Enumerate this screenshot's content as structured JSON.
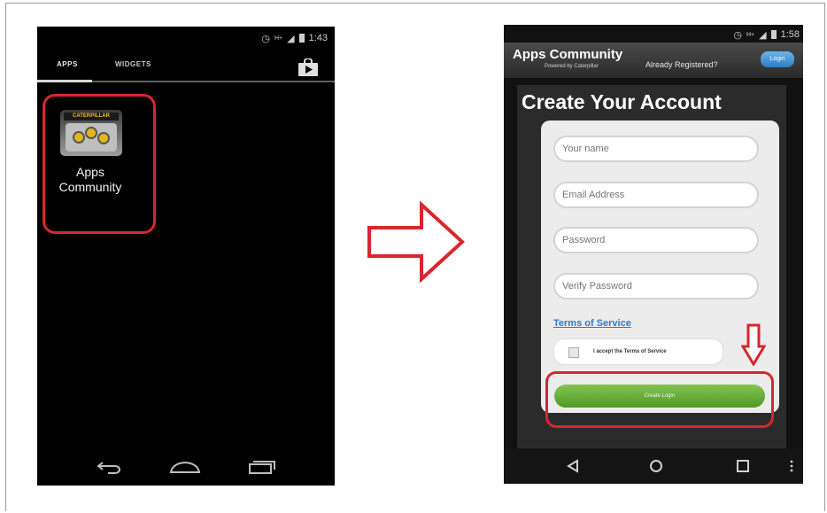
{
  "left_phone": {
    "status_time": "1:43",
    "status_network": "H+",
    "tabs": [
      {
        "label": "APPS",
        "active": true
      },
      {
        "label": "WIDGETS",
        "active": false
      }
    ],
    "store_icon": "play-store-bag-icon",
    "app": {
      "brand": "CATERPILLAR",
      "label_line1": "Apps",
      "label_line2": "Community"
    },
    "nav_icons": [
      "back-icon",
      "home-icon",
      "recent-apps-icon"
    ]
  },
  "right_phone": {
    "status_time": "1:58",
    "status_network": "H+",
    "header": {
      "title": "Apps Community",
      "subtitle": "Powered by Caterpillar",
      "already_registered": "Already Registered?",
      "login_label": "Login"
    },
    "heading": "Create Your Account",
    "fields": [
      {
        "name": "your-name-field",
        "placeholder": "Your name"
      },
      {
        "name": "email-field",
        "placeholder": "Email Address"
      },
      {
        "name": "password-field",
        "placeholder": "Password"
      },
      {
        "name": "verify-password-field",
        "placeholder": "Verify Password"
      }
    ],
    "terms_link": "Terms of Service",
    "accept_label": "I accept the Terms of Service",
    "create_button": "Create Login",
    "nav_icons": [
      "back-triangle-icon",
      "home-circle-icon",
      "recent-square-icon",
      "menu-dots-icon"
    ]
  },
  "colors": {
    "highlight": "#d9262e",
    "link": "#2e7bc9",
    "create_button": "#6aae3c",
    "login_button": "#3d8fd4"
  }
}
